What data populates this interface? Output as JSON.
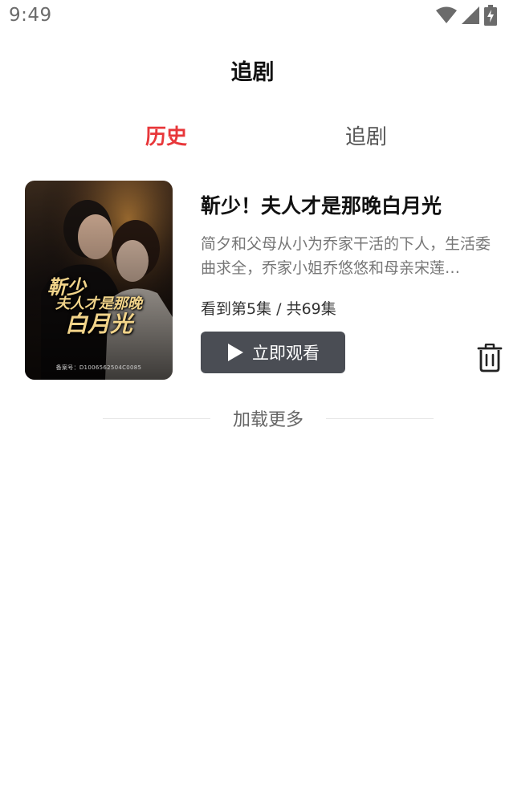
{
  "status_bar": {
    "time": "9:49",
    "icons": [
      "wifi-icon",
      "cell-signal-icon",
      "battery-charging-icon"
    ]
  },
  "header": {
    "title": "追剧"
  },
  "tabs": [
    {
      "label": "历史",
      "active": true,
      "color": "#e8373a"
    },
    {
      "label": "追剧",
      "active": false
    }
  ],
  "history": {
    "items": [
      {
        "title": "靳少！夫人才是那晚白月光",
        "description": "简夕和父母从小为乔家干活的下人，生活委曲求全，乔家小姐乔悠悠和母亲宋莲…",
        "progress": "看到第5集 / 共69集",
        "watch_label": "立即观看",
        "poster": {
          "line1": "靳少",
          "line2": "夫人才是那晚",
          "line3": "白月光",
          "caption": "备案号：D1006562504C0085"
        }
      }
    ],
    "load_more_label": "加载更多"
  },
  "colors": {
    "accent": "#e8373a",
    "button_bg": "#4a4d54"
  }
}
